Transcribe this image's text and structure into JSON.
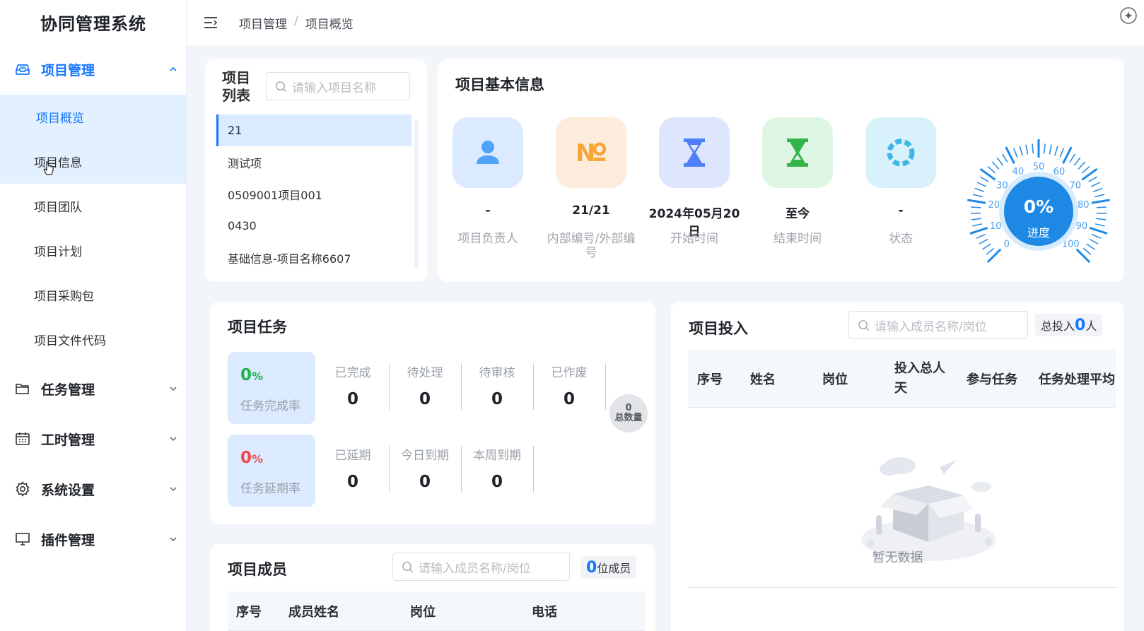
{
  "app": {
    "title": "协同管理系统"
  },
  "sidebar": {
    "groups": [
      {
        "label": "项目管理",
        "icon": "inbox-icon",
        "expanded": true
      },
      {
        "label": "任务管理",
        "icon": "folder-icon",
        "expanded": false
      },
      {
        "label": "工时管理",
        "icon": "calendar-icon",
        "expanded": false
      },
      {
        "label": "系统设置",
        "icon": "gear-icon",
        "expanded": false
      },
      {
        "label": "插件管理",
        "icon": "monitor-icon",
        "expanded": false
      }
    ],
    "sub_items": [
      {
        "label": "项目概览",
        "selected": true
      },
      {
        "label": "项目信息"
      },
      {
        "label": "项目团队"
      },
      {
        "label": "项目计划"
      },
      {
        "label": "项目采购包"
      },
      {
        "label": "项目文件代码"
      }
    ]
  },
  "header": {
    "breadcrumb": [
      "项目管理",
      "项目概览"
    ],
    "separator": "/"
  },
  "project_list": {
    "title": "项目列表",
    "search_placeholder": "请输入项目名称",
    "items": [
      "21",
      "测试项",
      "0509001项目001",
      "0430",
      "基础信息-项目名称6607"
    ]
  },
  "basic_info": {
    "title": "项目基本信息",
    "items": [
      {
        "value": "-",
        "label": "项目负责人",
        "icon": "person-icon",
        "tile_color": "#dbeafe",
        "icon_color": "#4fa3f7"
      },
      {
        "value": "21/21",
        "label": "内部编号/外部编号",
        "icon": "number-icon",
        "tile_color": "#fdebdc",
        "icon_color": "#f7a533"
      },
      {
        "value": "2024年05月20日",
        "label": "开始时间",
        "icon": "hourglass-icon",
        "tile_color": "#dde6fd",
        "icon_color": "#4f7ef7"
      },
      {
        "value": "至今",
        "label": "结束时间",
        "icon": "hourglass-green-icon",
        "tile_color": "#e0f6e4",
        "icon_color": "#33b54a"
      },
      {
        "value": "-",
        "label": "状态",
        "icon": "status-ring-icon",
        "tile_color": "#d9f1fb",
        "icon_color": "#3fb6e8"
      }
    ],
    "gauge": {
      "value_text": "0%",
      "label": "进度",
      "progress": 0,
      "ticks": [
        "0",
        "10",
        "20",
        "30",
        "40",
        "50",
        "60",
        "70",
        "80",
        "90",
        "100"
      ]
    }
  },
  "tasks": {
    "title": "项目任务",
    "completion_rate": {
      "value": "0",
      "unit": "%",
      "label": "任务完成率",
      "color": "#22b14c"
    },
    "delay_rate": {
      "value": "0",
      "unit": "%",
      "label": "任务延期率",
      "color": "#f04b4b"
    },
    "row1": [
      {
        "label": "已完成",
        "value": "0"
      },
      {
        "label": "待处理",
        "value": "0"
      },
      {
        "label": "待审核",
        "value": "0"
      },
      {
        "label": "已作废",
        "value": "0"
      }
    ],
    "row2": [
      {
        "label": "已延期",
        "value": "0"
      },
      {
        "label": "今日到期",
        "value": "0"
      },
      {
        "label": "本周到期",
        "value": "0"
      }
    ],
    "total": {
      "value": "0",
      "label": "总数量"
    }
  },
  "members": {
    "title": "项目成员",
    "search_placeholder": "请输入成员名称/岗位",
    "count": "0",
    "count_suffix": "位成员",
    "columns": [
      "序号",
      "成员姓名",
      "岗位",
      "电话"
    ]
  },
  "investment": {
    "title": "项目投入",
    "search_placeholder": "请输入成员名称/岗位",
    "total_prefix": "总投入",
    "total_count": "0",
    "total_suffix": "人",
    "columns": [
      "序号",
      "姓名",
      "岗位",
      "投入总人天",
      "参与任务",
      "任务处理平均"
    ],
    "empty_text": "暂无数据"
  }
}
